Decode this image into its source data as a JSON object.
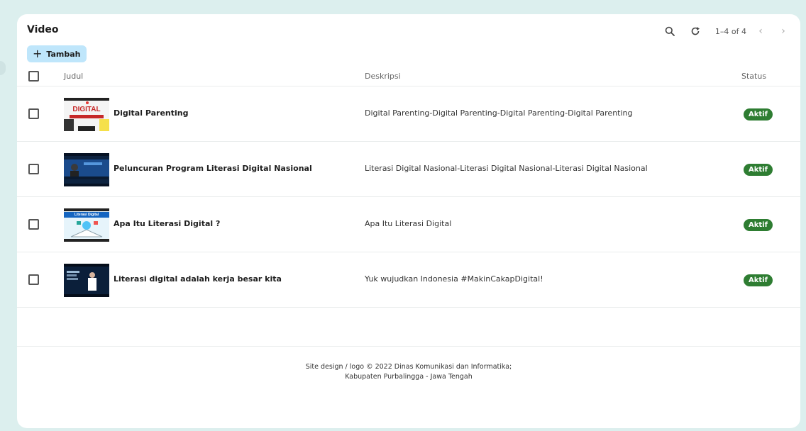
{
  "page": {
    "title": "Video",
    "add_button": "Tambah",
    "pagination": "1–4 of 4"
  },
  "icons": {
    "search": "search-icon",
    "refresh": "refresh-icon",
    "prev": "chevron-left-icon",
    "next": "chevron-right-icon",
    "add": "plus-icon"
  },
  "columns": {
    "judul": "Judul",
    "deskripsi": "Deskripsi",
    "status": "Status"
  },
  "rows": [
    {
      "title": "Digital Parenting",
      "description": "Digital Parenting-Digital Parenting-Digital Parenting-Digital Parenting",
      "status": "Aktif",
      "thumb_text": "DIGITAL"
    },
    {
      "title": "Peluncuran Program Literasi Digital Nasional",
      "description": "Literasi Digital Nasional-Literasi Digital Nasional-Literasi Digital Nasional",
      "status": "Aktif"
    },
    {
      "title": "Apa Itu Literasi Digital ?",
      "description": "Apa Itu Literasi Digital",
      "status": "Aktif",
      "thumb_text": "Literasi Digital"
    },
    {
      "title": "Literasi digital adalah kerja besar kita",
      "description": "Yuk wujudkan Indonesia #MakinCakapDigital!",
      "status": "Aktif"
    }
  ],
  "footer": {
    "line1": "Site design / logo © 2022 Dinas Komunikasi dan Informatika;",
    "line2": "Kabupaten Purbalingga - Jawa Tengah"
  },
  "colors": {
    "background": "#dcefee",
    "add_button": "#bfe6fb",
    "status_active": "#2e7d32"
  }
}
